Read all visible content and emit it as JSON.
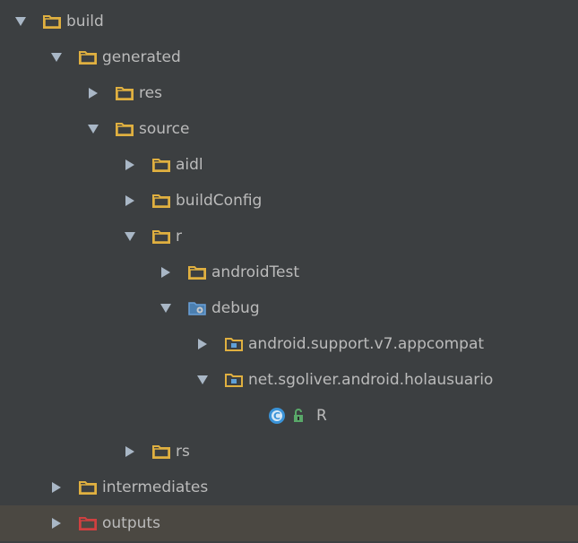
{
  "colors": {
    "background": "#3c3f41",
    "text": "#bbbbbb",
    "folder": "#e0b040",
    "folder_excluded": "#d04040",
    "package_dot": "#5fa0d8",
    "arrow": "#a9b7c6",
    "class_icon": "#3a93d8",
    "lock_icon": "#59a869",
    "selection": "#4b4842"
  },
  "tree": [
    {
      "label": "build",
      "depth": 0,
      "expanded": true,
      "icon": "folder-icon"
    },
    {
      "label": "generated",
      "depth": 1,
      "expanded": true,
      "icon": "folder-icon"
    },
    {
      "label": "res",
      "depth": 2,
      "expanded": false,
      "icon": "folder-icon"
    },
    {
      "label": "source",
      "depth": 2,
      "expanded": true,
      "icon": "folder-icon"
    },
    {
      "label": "aidl",
      "depth": 3,
      "expanded": false,
      "icon": "folder-icon"
    },
    {
      "label": "buildConfig",
      "depth": 3,
      "expanded": false,
      "icon": "folder-icon"
    },
    {
      "label": "r",
      "depth": 3,
      "expanded": true,
      "icon": "folder-icon"
    },
    {
      "label": "androidTest",
      "depth": 4,
      "expanded": false,
      "icon": "folder-icon"
    },
    {
      "label": "debug",
      "depth": 4,
      "expanded": true,
      "icon": "source-root-folder-icon"
    },
    {
      "label": "android.support.v7.appcompat",
      "depth": 5,
      "expanded": false,
      "icon": "package-icon"
    },
    {
      "label": "net.sgoliver.android.holausuario",
      "depth": 5,
      "expanded": true,
      "icon": "package-icon"
    },
    {
      "label": "R",
      "depth": 6,
      "expanded": null,
      "icon": "class-icon"
    },
    {
      "label": "rs",
      "depth": 3,
      "expanded": false,
      "icon": "folder-icon"
    },
    {
      "label": "intermediates",
      "depth": 1,
      "expanded": false,
      "icon": "folder-icon"
    },
    {
      "label": "outputs",
      "depth": 1,
      "expanded": false,
      "icon": "excluded-folder-icon"
    }
  ]
}
